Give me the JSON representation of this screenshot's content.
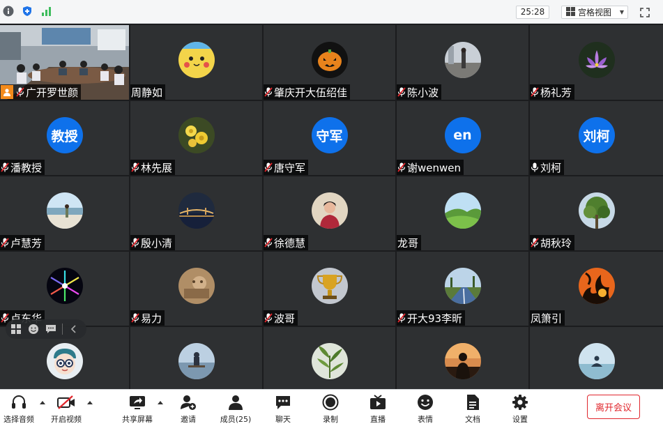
{
  "topbar": {
    "timer": "25:28",
    "view_label": "宫格视图",
    "icons": [
      "info-icon",
      "shield-icon",
      "signal-icon",
      "grid-view-icon",
      "fullscreen-icon"
    ]
  },
  "participants": [
    {
      "name": "广开罗世颜",
      "mic": "muted",
      "avatar": "video",
      "host": true
    },
    {
      "name": "周静如",
      "mic": "none",
      "avatar": "pikachu"
    },
    {
      "name": "肇庆开大伍绍佳",
      "mic": "muted",
      "avatar": "pumpkin"
    },
    {
      "name": "陈小波",
      "mic": "muted",
      "avatar": "street"
    },
    {
      "name": "杨礼芳",
      "mic": "muted",
      "avatar": "lotus"
    },
    {
      "name": "潘教授",
      "mic": "muted",
      "avatar": "text",
      "text": "教授"
    },
    {
      "name": "林先展",
      "mic": "muted",
      "avatar": "roses"
    },
    {
      "name": "唐守军",
      "mic": "muted",
      "avatar": "text",
      "text": "守军"
    },
    {
      "name": "谢wenwen",
      "mic": "muted",
      "avatar": "text",
      "text": "en"
    },
    {
      "name": "刘柯",
      "mic": "on",
      "avatar": "text",
      "text": "刘柯"
    },
    {
      "name": "卢慧芳",
      "mic": "muted",
      "avatar": "beach"
    },
    {
      "name": "殷小清",
      "mic": "muted",
      "avatar": "bridge"
    },
    {
      "name": "徐德慧",
      "mic": "muted",
      "avatar": "woman"
    },
    {
      "name": "龙哥",
      "mic": "none",
      "avatar": "hills"
    },
    {
      "name": "胡秋玲",
      "mic": "muted",
      "avatar": "tree"
    },
    {
      "name": "卢东华",
      "mic": "muted",
      "avatar": "firework"
    },
    {
      "name": "易力",
      "mic": "muted",
      "avatar": "sepia"
    },
    {
      "name": "波哥",
      "mic": "muted",
      "avatar": "trophy"
    },
    {
      "name": "开大93李昕",
      "mic": "muted",
      "avatar": "road"
    },
    {
      "name": "凤箫引",
      "mic": "none",
      "avatar": "fire"
    },
    {
      "name": "",
      "mic": "none",
      "avatar": "cartoon"
    },
    {
      "name": "",
      "mic": "none",
      "avatar": "lake"
    },
    {
      "name": "",
      "mic": "none",
      "avatar": "plant"
    },
    {
      "name": "",
      "mic": "none",
      "avatar": "silhouette"
    },
    {
      "name": "",
      "mic": "none",
      "avatar": "meditate"
    }
  ],
  "toolbar": {
    "audio": "选择音频",
    "video": "开启视频",
    "share": "共享屏幕",
    "invite": "邀请",
    "members": "成员(25)",
    "chat": "聊天",
    "record": "录制",
    "live": "直播",
    "emoji": "表情",
    "docs": "文档",
    "settings": "设置",
    "leave": "离开会议"
  },
  "colors": {
    "tile_bg": "#2e3032",
    "grid_gap": "#1b1c1e",
    "text_avatar": "#0e71eb",
    "mute_red": "#e0262c",
    "host_orange": "#f38b1c",
    "signal_green": "#3cbc5c"
  }
}
